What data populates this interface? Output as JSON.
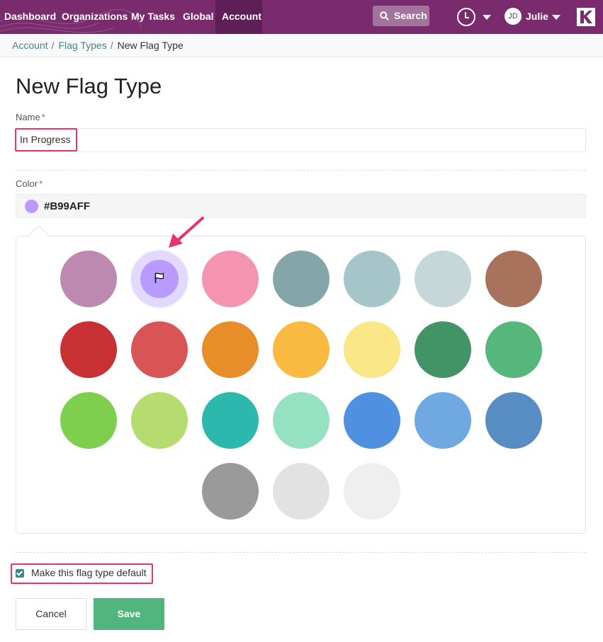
{
  "nav": {
    "items": [
      "Dashboard",
      "Organizations",
      "My Tasks",
      "Global",
      "Account"
    ],
    "active": "Account",
    "search_label": "Search",
    "user_initials": "JD",
    "user_name": "Julie"
  },
  "breadcrumb": {
    "items": [
      "Account",
      "Flag Types"
    ],
    "current": "New Flag Type"
  },
  "page_title": "New Flag Type",
  "form": {
    "name_label": "Name",
    "name_value": "In Progress",
    "color_label": "Color",
    "color_value": "#B99AFF",
    "required_mark": "*",
    "default_checkbox_label": "Make this flag type default",
    "default_checked": true,
    "cancel_label": "Cancel",
    "save_label": "Save"
  },
  "palette": {
    "selected": "#B99AFF",
    "colors": [
      "#BE89B1",
      "#B99AFF",
      "#F494B0",
      "#85A6A8",
      "#A6C5C9",
      "#C6D7D9",
      "#A9725D",
      "#C73133",
      "#D95454",
      "#E78E2B",
      "#FAB940",
      "#FAE787",
      "#429466",
      "#56B77D",
      "#7ECF50",
      "#B6DB70",
      "#2DB8AD",
      "#97E1C3",
      "#4F91E0",
      "#70A8E1",
      "#578DC3",
      "#9A9A9A",
      "#E2E2E2",
      "#EFEFEF"
    ]
  },
  "accent_colors": {
    "nav": "#7a2b6e",
    "highlight": "#e8336f",
    "save": "#52b57d"
  }
}
